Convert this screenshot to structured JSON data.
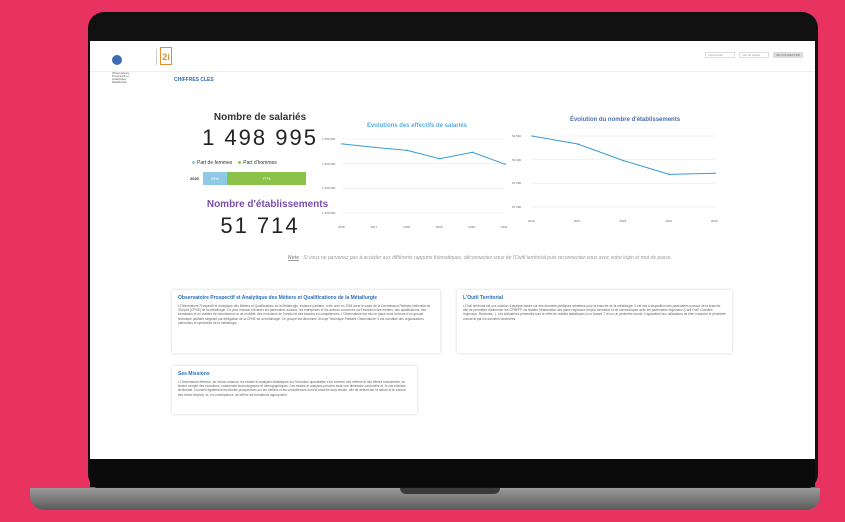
{
  "header": {
    "logo1_text": "Observatoire Prospectif et Analytique Métallurgie",
    "logo2_text": "2i",
    "login_placeholder": "votre email",
    "password_placeholder": "mot de passe",
    "login_button": "SE CONNECTER"
  },
  "page": {
    "section_title": "CHIFFRES CLES"
  },
  "kpis": {
    "employees_label": "Nombre de salariés",
    "employees_value": "1 498 995",
    "women_legend": "Part de femmes",
    "men_legend": "Part d'hommes",
    "bar_year": "2020",
    "women_pct": "23%",
    "men_pct": "77%",
    "establishments_label": "Nombre d'établissements",
    "establishments_value": "51 714"
  },
  "colors": {
    "women": "#8ecae6",
    "men": "#8bc34a",
    "line": "#3a9bd6",
    "accent": "#2b6db5",
    "kpi2": "#7b4fa8"
  },
  "chart_data": [
    {
      "type": "line",
      "title": "Evolutions des effectifs de salariés",
      "x": [
        "2016",
        "2017",
        "2018",
        "2019",
        "2020",
        "2021"
      ],
      "y_ticks": [
        "1 550 000",
        "1 500 000",
        "1 450 000",
        "1 400 000"
      ],
      "values": [
        1540000,
        1533000,
        1527000,
        1510000,
        1523000,
        1499000
      ],
      "ylim": [
        1400000,
        1550000
      ],
      "grid": true
    },
    {
      "type": "line",
      "title": "Évolution du nombre d'établissements",
      "x": [
        "2016",
        "2017",
        "2018",
        "2019",
        "2020"
      ],
      "y_ticks": [
        "52 500",
        "52 000",
        "51 500",
        "51 000"
      ],
      "values": [
        52500,
        52330,
        51980,
        51690,
        51714
      ],
      "ylim": [
        51000,
        52500
      ],
      "grid": true
    }
  ],
  "note": {
    "label": "Note",
    "text": " : Si vous ne parvenez pas à accéder aux différents rapports thématiques, déconnectez-vous de l'Outil territorial puis reconnectez-vous avec votre login et mot de passe."
  },
  "cards": {
    "observatoire_title": "Observatoire Prospectif et Analytique des Métiers et Qualifications de la Métallurgie",
    "observatoire_text": "L'Observatoire Prospectif et Analytique des Métiers et Qualifications de la Métallurgie, instance paritaire, a été créé en 2004 dans le cadre de la Commission Paritaire Nationale de l'Emploi (CPNE) de la métallurgie. Il a pour mission d'éclairer les partenaires sociaux, les entreprises et les acteurs concernés sur l'évolution des métiers, des qualifications, des formations et en matière de recrutement ou de mobilité, des évolutions de l'emploi et des besoins en compétences. L'Observatoire est mis en place sous la forme d'un groupe technique paritaire siégeant par délégation de la CPNE de la métallurgie. Ce groupe est dénommé Groupe Technique Paritaire Observatoire. Il est constitué des organisations patronales et syndicales de la métallurgie.",
    "outil_title": "L'Outil Territorial",
    "outil_text": "L'Outil territorial est une solution d'analyse basée sur des données publiques retraitées pour la branche de la métallurgie. Il est mis à disposition des partenaires sociaux de la branche afin de permettre d'alimenter les CPREFP, de faciliter l'élaboration des plans régionaux emploi-formation et de communiquer avec les partenaires régionaux (Carif-Oref, Conseils régionaux, Rectorats...). Les indicateurs présentés sont le reflet de réalités statistiques à un instant T et sur un périmètre donné. Il appartient aux utilisateurs de bien s'assurer le périmètre concerné par les données observées.",
    "missions_title": "Ses Missions",
    "missions_text": "L'Observatoire effectue, au niveau national, les études et analyses statistiques sur l'évolution quantitative et le contenu des métiers et des filières industrielles, en tenant compte des évolutions, notamment technologiques et démographiques. Ces études et analyses peuvent avoir une dimension sectorielle et, le cas échéant, territoriale. Il conduit également les études prospectives sur les métiers et les compétences dont la branche aura besoin, afin de déterminer la nature et le volume des futurs emplois, et, en conséquence, de définir les formations appropriées."
  }
}
